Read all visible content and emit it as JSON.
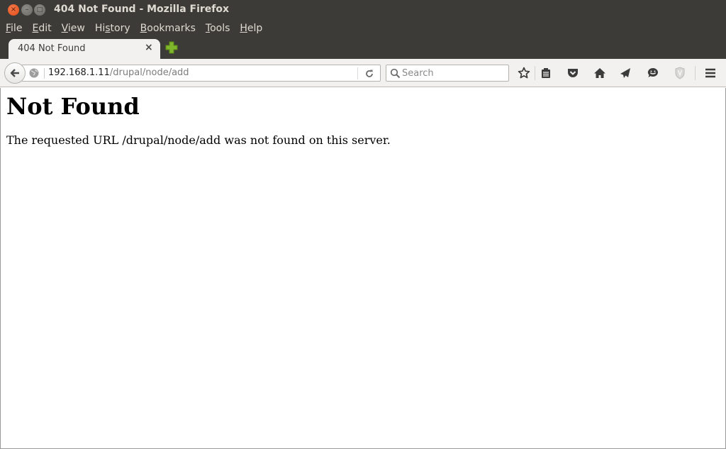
{
  "window": {
    "title": "404 Not Found - Mozilla Firefox",
    "controls": {
      "close": "×",
      "minimize": "–",
      "maximize": "□"
    }
  },
  "menubar": {
    "items": [
      {
        "label": "File",
        "accel": "F",
        "rest": "ile"
      },
      {
        "label": "Edit",
        "accel": "E",
        "rest": "dit"
      },
      {
        "label": "View",
        "accel": "V",
        "rest": "iew"
      },
      {
        "label": "History",
        "pre": "Hi",
        "accel": "s",
        "rest": "tory"
      },
      {
        "label": "Bookmarks",
        "accel": "B",
        "rest": "ookmarks"
      },
      {
        "label": "Tools",
        "accel": "T",
        "rest": "ools"
      },
      {
        "label": "Help",
        "accel": "H",
        "rest": "elp"
      }
    ]
  },
  "tabs": [
    {
      "label": "404 Not Found",
      "close": "×",
      "active": true
    }
  ],
  "toolbar": {
    "url_host": "192.168.1.11",
    "url_path": "/drupal/node/add",
    "reload_glyph": "↻",
    "search_placeholder": "Search",
    "icons": [
      "bookmark-star-icon",
      "reading-list-icon",
      "pocket-icon",
      "home-icon",
      "share-icon",
      "chat-icon",
      "shield-icon",
      "hamburger-menu-icon"
    ],
    "colors": {
      "accent_green": "#7fb62b",
      "close_orange": "#e85a22"
    }
  },
  "page": {
    "heading": "Not Found",
    "message": "The requested URL /drupal/node/add was not found on this server."
  }
}
